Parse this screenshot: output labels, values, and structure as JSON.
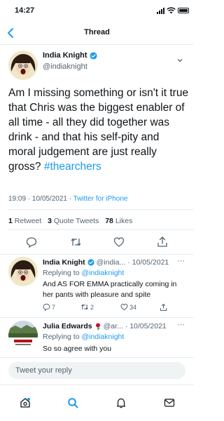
{
  "status_bar": {
    "time": "14:27"
  },
  "nav": {
    "title": "Thread"
  },
  "main_tweet": {
    "name": "India Knight",
    "handle": "@indiaknight",
    "text": "Am I missing something or isn't it true that Chris was the biggest enabler of all time - all they did together was drink - and that his self-pity and moral judgement are just really gross?",
    "hashtag": "#thearchers",
    "time": "19:09 · 10/05/2021 · ",
    "source": "Twitter for iPhone",
    "retweets_count": "1",
    "retweets_label": "Retweet",
    "quotes_count": "3",
    "quotes_label": "Quote Tweets",
    "likes_count": "78",
    "likes_label": "Likes"
  },
  "reply_1": {
    "name": "India Knight",
    "handle": "@india...",
    "date": "· 10/05/2021",
    "replying_prefix": "Replying to ",
    "replying_to": "@indiaknight",
    "text": "And AS FOR EMMA practically coming in her pants with pleasure and spite",
    "reply_count": "7",
    "retweet_count": "2",
    "like_count": "34"
  },
  "reply_2": {
    "name": "Julia Edwards",
    "handle": "@ar...",
    "date": "· 10/05/2021",
    "replying_prefix": "Replying to ",
    "replying_to": "@indiaknight",
    "text": "So so agree with you"
  },
  "composer": {
    "placeholder": "Tweet your reply"
  },
  "colors": {
    "accent": "#1d9bf0",
    "text": "#0f1419",
    "muted": "#536471",
    "verified": "#1d9bf0"
  },
  "icons": [
    "back-chevron-icon",
    "verified-badge-icon",
    "reply-icon",
    "retweet-icon",
    "like-icon",
    "share-icon",
    "home-icon",
    "search-icon",
    "notifications-icon",
    "messages-icon"
  ]
}
